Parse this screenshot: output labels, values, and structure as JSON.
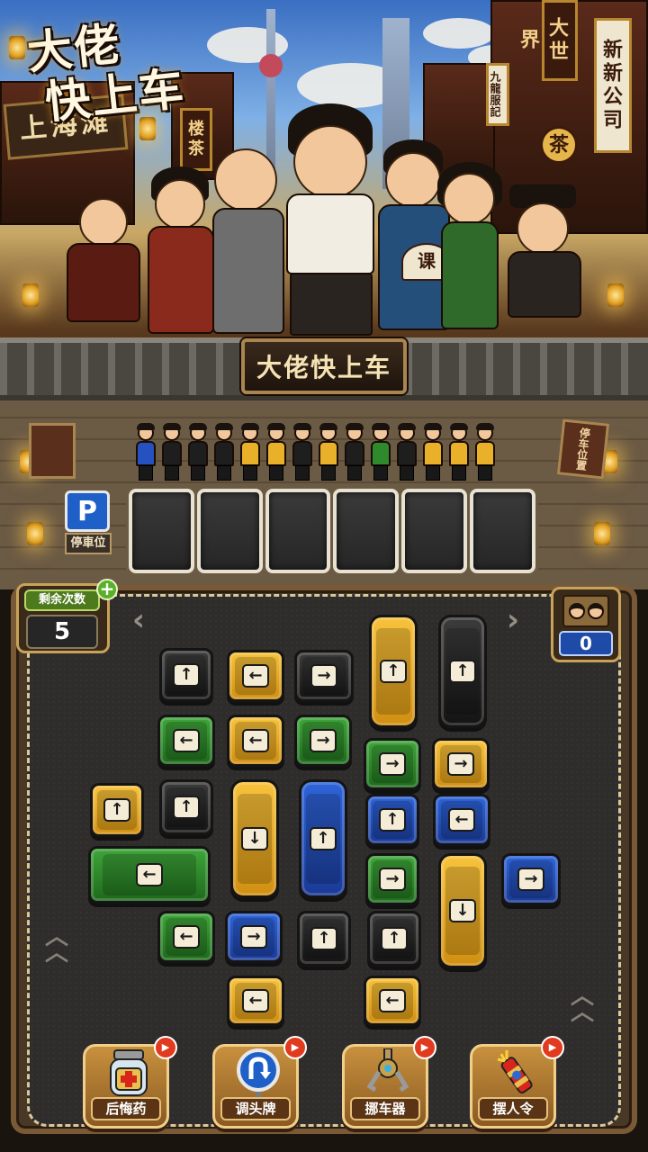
{
  "header": {
    "logo_line1": "大佬",
    "logo_line2": "快上车",
    "title_plaque": "大佬快上车",
    "signs": {
      "left_main": "上海滩",
      "left_tea": "楼茶",
      "right_big_world": "大世界",
      "right_company": "新新公司",
      "right_tea": "茶",
      "right_small": "九龍服記",
      "fan_text": "课"
    }
  },
  "queue": {
    "passenger_colors": [
      "blue",
      "black",
      "black",
      "black",
      "yellow",
      "yellow",
      "black",
      "yellow",
      "black",
      "green",
      "black",
      "yellow",
      "yellow",
      "yellow"
    ]
  },
  "parking": {
    "sign_letter": "P",
    "label": "停車位"
  },
  "plaza_sign": "停车位置",
  "slots": {
    "count": 6
  },
  "hud": {
    "moves_label": "剩余次数",
    "moves_value": "5",
    "moves_plus": "+",
    "counter_value": "0"
  },
  "nav": {
    "left_arrow": "‹",
    "right_arrow": "›",
    "scroll_up": "︿"
  },
  "cars": [
    {
      "color": "black",
      "dir": "up"
    },
    {
      "color": "yellow",
      "dir": "left"
    },
    {
      "color": "black",
      "dir": "right"
    },
    {
      "color": "yellow",
      "dir": "up"
    },
    {
      "color": "black",
      "dir": "up"
    },
    {
      "color": "green",
      "dir": "left"
    },
    {
      "color": "yellow",
      "dir": "left"
    },
    {
      "color": "green",
      "dir": "right"
    },
    {
      "color": "green",
      "dir": "right"
    },
    {
      "color": "yellow",
      "dir": "right"
    },
    {
      "color": "yellow",
      "dir": "up"
    },
    {
      "color": "black",
      "dir": "up"
    },
    {
      "color": "yellow",
      "dir": "down"
    },
    {
      "color": "blue",
      "dir": "up"
    },
    {
      "color": "blue",
      "dir": "up"
    },
    {
      "color": "blue",
      "dir": "left"
    },
    {
      "color": "green",
      "dir": "left"
    },
    {
      "color": "green",
      "dir": "right"
    },
    {
      "color": "yellow",
      "dir": "down"
    },
    {
      "color": "blue",
      "dir": "right"
    },
    {
      "color": "green",
      "dir": "left"
    },
    {
      "color": "blue",
      "dir": "right"
    },
    {
      "color": "black",
      "dir": "up"
    },
    {
      "color": "black",
      "dir": "up"
    },
    {
      "color": "yellow",
      "dir": "left"
    },
    {
      "color": "yellow",
      "dir": "left"
    }
  ],
  "powerups": [
    {
      "label": "后悔药",
      "icon": "medicine-jar-icon"
    },
    {
      "label": "调头牌",
      "icon": "u-turn-sign-icon"
    },
    {
      "label": "挪车器",
      "icon": "claw-machine-icon"
    },
    {
      "label": "摆人令",
      "icon": "firecracker-icon"
    }
  ],
  "colors": {
    "black": "#1e1e1e",
    "yellow": "#e9a82a",
    "green": "#2e8a2a",
    "blue": "#2552c0",
    "board": "#2f2d2c",
    "gold": "#c9a259",
    "moves_green": "#4e7a1e"
  }
}
